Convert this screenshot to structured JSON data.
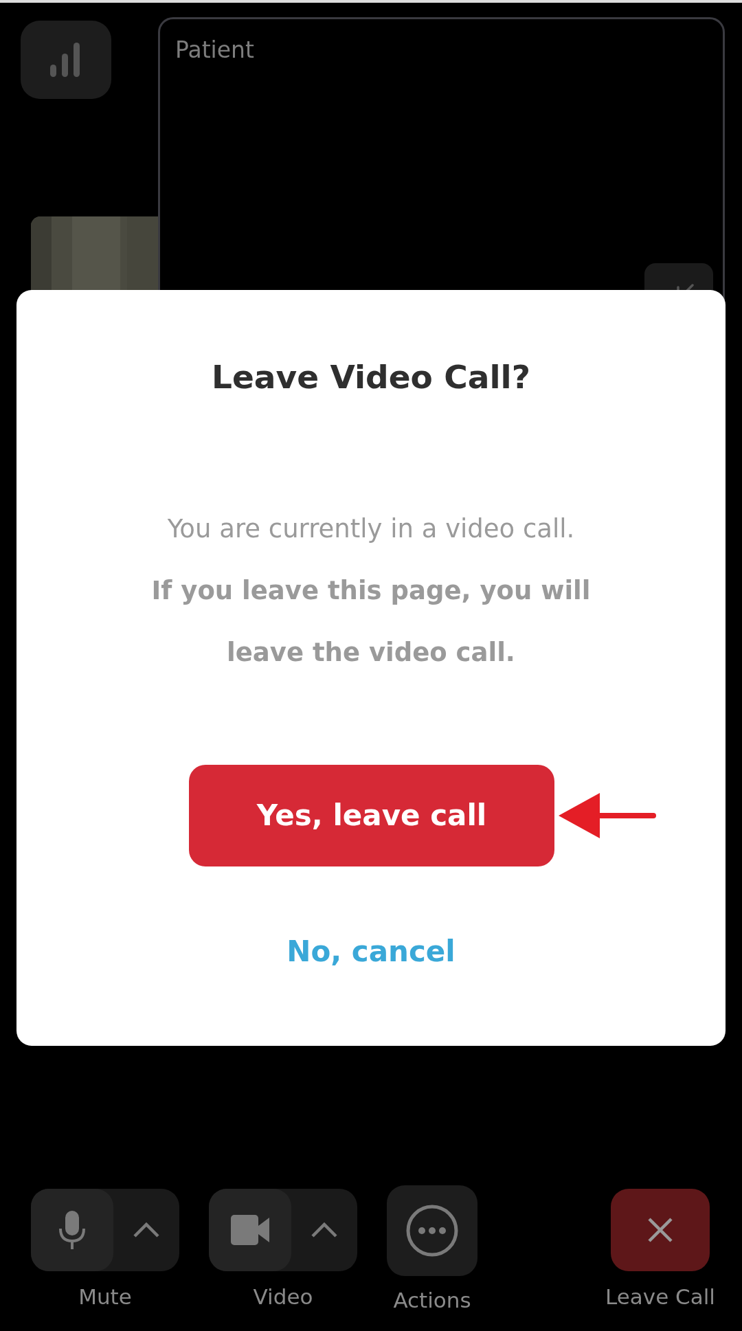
{
  "call": {
    "participant_label": "Patient"
  },
  "dialog": {
    "title": "Leave Video Call?",
    "message": "You are currently in a video call.",
    "warning": "If you leave this page, you will leave the video call.",
    "confirm_button": "Yes, leave call",
    "cancel_link": "No, cancel"
  },
  "toolbar": [
    {
      "kind": "split",
      "label": "Mute"
    },
    {
      "kind": "split",
      "label": "Video"
    },
    {
      "kind": "single",
      "label": "Actions"
    },
    {
      "kind": "danger",
      "label": "Leave Call"
    }
  ]
}
